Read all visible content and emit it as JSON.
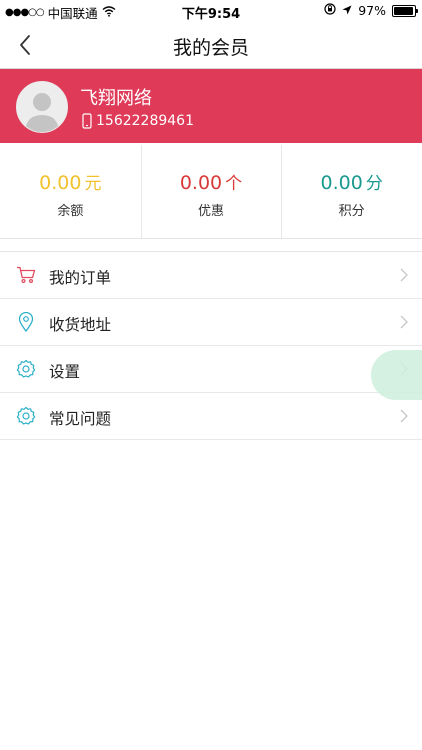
{
  "status_bar": {
    "signal_dots": "●●●○○",
    "carrier": "中国联通",
    "time": "下午9:54",
    "battery": "97%",
    "battery_level": 0.97
  },
  "nav": {
    "title": "我的会员",
    "back_icon": "chevron-left-icon"
  },
  "profile": {
    "name": "飞翔网络",
    "phone": "15622289461",
    "background_color": "#df3b58"
  },
  "stats": [
    {
      "value": "0.00",
      "unit": "元",
      "label": "余额",
      "color": "#f2c12e"
    },
    {
      "value": "0.00",
      "unit": "个",
      "label": "优惠",
      "color": "#d83a3a"
    },
    {
      "value": "0.00",
      "unit": "分",
      "label": "积分",
      "color": "#1a9a8f"
    }
  ],
  "menu": [
    {
      "label": "我的订单",
      "icon": "cart-icon",
      "icon_color": "#e24b60"
    },
    {
      "label": "收货地址",
      "icon": "location-pin-icon",
      "icon_color": "#2ab0c8"
    },
    {
      "label": "设置",
      "icon": "gear-icon",
      "icon_color": "#2ab0c8"
    },
    {
      "label": "常见问题",
      "icon": "gear-icon",
      "icon_color": "#2ab0c8"
    }
  ]
}
